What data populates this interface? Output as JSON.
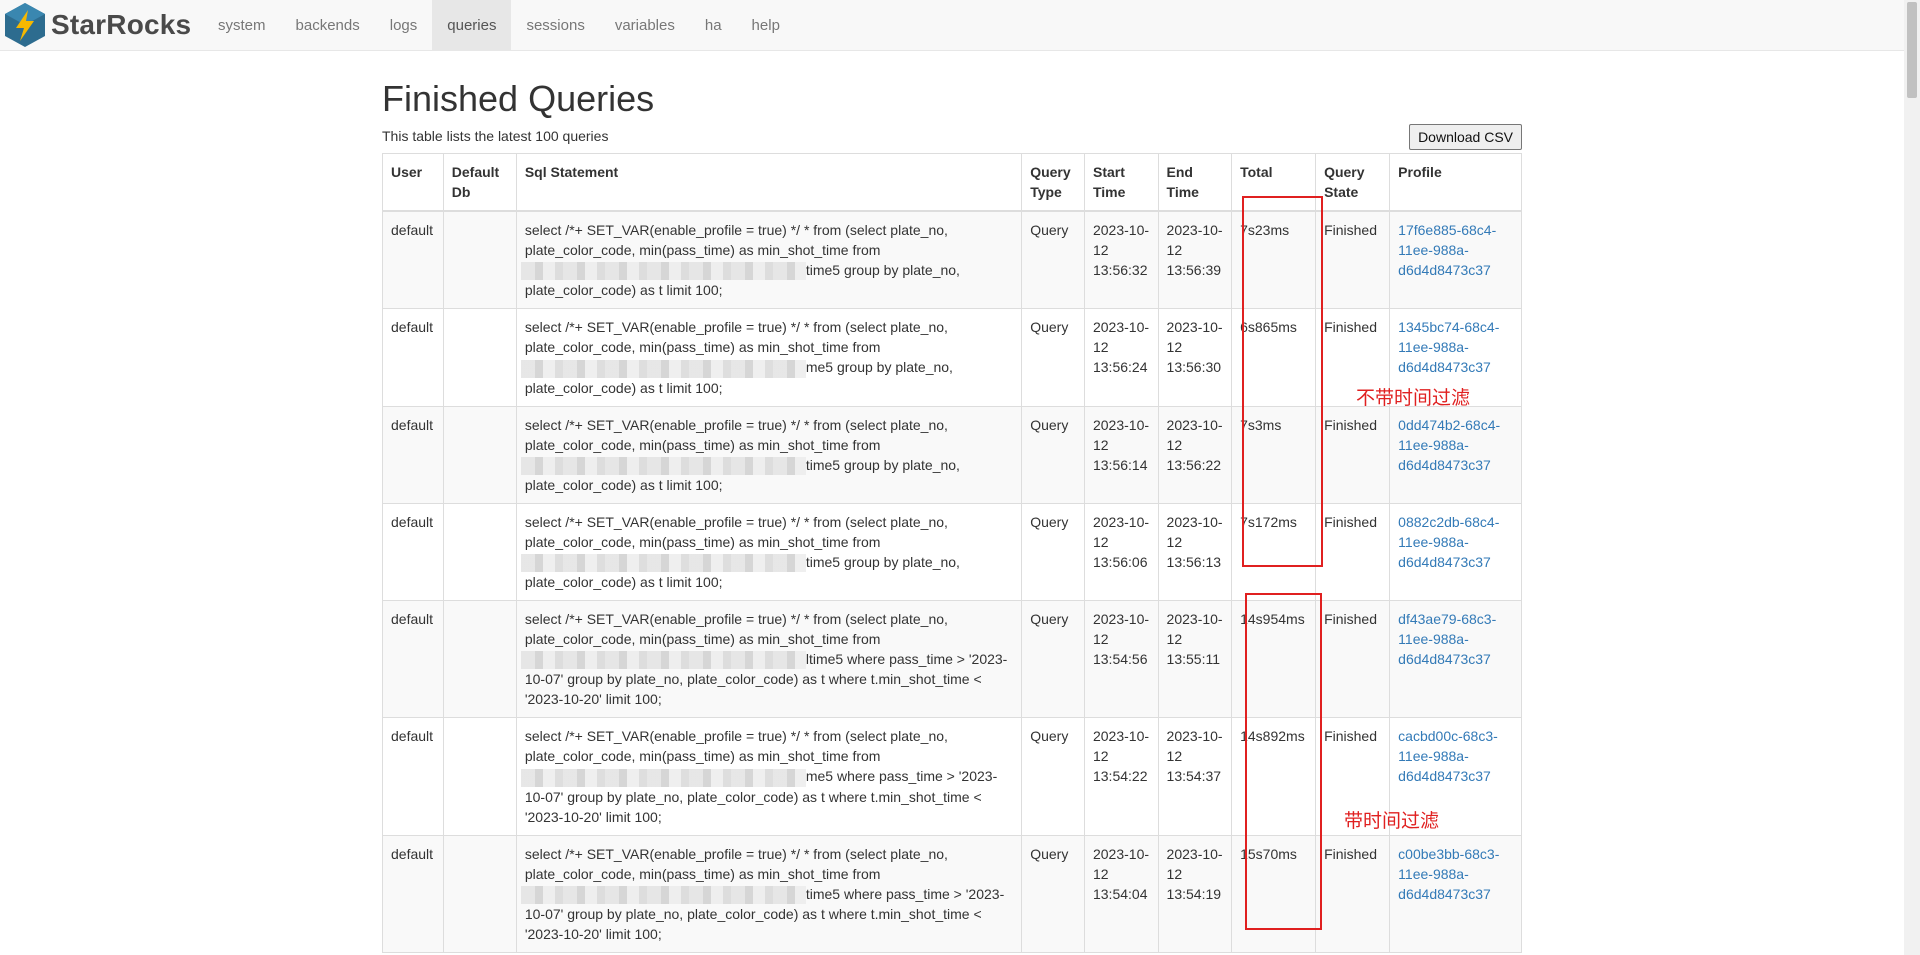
{
  "brand": {
    "name": "StarRocks"
  },
  "nav": [
    "system",
    "backends",
    "logs",
    "queries",
    "sessions",
    "variables",
    "ha",
    "help"
  ],
  "nav_active": "queries",
  "page": {
    "title": "Finished Queries",
    "subtitle": "This table lists the latest 100 queries",
    "download_label": "Download CSV"
  },
  "table": {
    "headers": {
      "user": "User",
      "default_db": "Default Db",
      "sql": "Sql Statement",
      "query_type": "Query Type",
      "start_time": "Start Time",
      "end_time": "End Time",
      "total": "Total",
      "query_state": "Query State",
      "profile": "Profile"
    },
    "rows": [
      {
        "user": "default",
        "db": "",
        "sql_a": "select /*+ SET_VAR(enable_profile = true) */ * from (select plate_no, plate_color_code, min(pass_time) as min_shot_time from",
        "sql_b": "time5 group by plate_no, plate_color_code) as t limit 100;",
        "type": "Query",
        "start": "2023-10-12 13:56:32",
        "end": "2023-10-12 13:56:39",
        "total": "7s23ms",
        "state": "Finished",
        "profile": "17f6e885-68c4-11ee-988a-d6d4d8473c37"
      },
      {
        "user": "default",
        "db": "",
        "sql_a": "select /*+ SET_VAR(enable_profile = true) */ * from (select plate_no, plate_color_code, min(pass_time) as min_shot_time from",
        "sql_b": "me5 group by plate_no, plate_color_code) as t limit 100;",
        "type": "Query",
        "start": "2023-10-12 13:56:24",
        "end": "2023-10-12 13:56:30",
        "total": "6s865ms",
        "state": "Finished",
        "profile": "1345bc74-68c4-11ee-988a-d6d4d8473c37"
      },
      {
        "user": "default",
        "db": "",
        "sql_a": "select /*+ SET_VAR(enable_profile = true) */ * from (select plate_no, plate_color_code, min(pass_time) as min_shot_time from",
        "sql_b": "time5 group by plate_no, plate_color_code) as t limit 100;",
        "type": "Query",
        "start": "2023-10-12 13:56:14",
        "end": "2023-10-12 13:56:22",
        "total": "7s3ms",
        "state": "Finished",
        "profile": "0dd474b2-68c4-11ee-988a-d6d4d8473c37"
      },
      {
        "user": "default",
        "db": "",
        "sql_a": "select /*+ SET_VAR(enable_profile = true) */ * from (select plate_no, plate_color_code, min(pass_time) as min_shot_time from",
        "sql_b": "time5 group by plate_no, plate_color_code) as t limit 100;",
        "type": "Query",
        "start": "2023-10-12 13:56:06",
        "end": "2023-10-12 13:56:13",
        "total": "7s172ms",
        "state": "Finished",
        "profile": "0882c2db-68c4-11ee-988a-d6d4d8473c37"
      },
      {
        "user": "default",
        "db": "",
        "sql_a": "select /*+ SET_VAR(enable_profile = true) */ * from (select plate_no, plate_color_code, min(pass_time) as min_shot_time from",
        "sql_b": "ltime5 where pass_time > '2023-10-07' group by plate_no, plate_color_code) as t where t.min_shot_time < '2023-10-20' limit 100;",
        "type": "Query",
        "start": "2023-10-12 13:54:56",
        "end": "2023-10-12 13:55:11",
        "total": "14s954ms",
        "state": "Finished",
        "profile": "df43ae79-68c3-11ee-988a-d6d4d8473c37"
      },
      {
        "user": "default",
        "db": "",
        "sql_a": "select /*+ SET_VAR(enable_profile = true) */ * from (select plate_no, plate_color_code, min(pass_time) as min_shot_time from",
        "sql_b": "me5 where pass_time > '2023-10-07' group by plate_no, plate_color_code) as t where t.min_shot_time < '2023-10-20' limit 100;",
        "type": "Query",
        "start": "2023-10-12 13:54:22",
        "end": "2023-10-12 13:54:37",
        "total": "14s892ms",
        "state": "Finished",
        "profile": "cacbd00c-68c3-11ee-988a-d6d4d8473c37"
      },
      {
        "user": "default",
        "db": "",
        "sql_a": "select /*+ SET_VAR(enable_profile = true) */ * from (select plate_no, plate_color_code, min(pass_time) as min_shot_time from",
        "sql_b": "time5 where pass_time > '2023-10-07' group by plate_no, plate_color_code) as t where t.min_shot_time < '2023-10-20' limit 100;",
        "type": "Query",
        "start": "2023-10-12 13:54:04",
        "end": "2023-10-12 13:54:19",
        "total": "15s70ms",
        "state": "Finished",
        "profile": "c00be3bb-68c3-11ee-988a-d6d4d8473c37"
      }
    ]
  },
  "annotations": {
    "no_time_filter": "不带时间过滤",
    "with_time_filter": "带时间过滤",
    "color": "#e02020"
  }
}
